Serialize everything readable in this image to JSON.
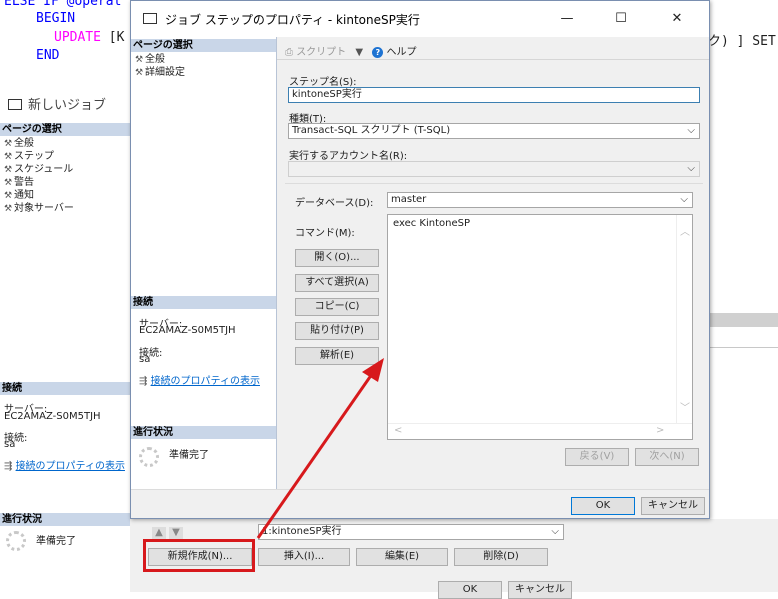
{
  "background_editor": {
    "line1": "ELSE IF @operat",
    "line2": "BEGIN",
    "line3_kw": "UPDATE",
    "line3_rest": "[K",
    "line4": "END",
    "right_tail": "ク) ] SET"
  },
  "background_job": {
    "title": "新しいジョブ",
    "page_select_header": "ページの選択",
    "pages": [
      "全般",
      "ステップ",
      "スケジュール",
      "警告",
      "通知",
      "対象サーバー"
    ],
    "connection_header": "接続",
    "server_label": "サーバー:",
    "server_value": "EC2AMAZ-S0M5TJH",
    "connection_label": "接続:",
    "connection_value": "sa",
    "connection_link": "接続のプロパティの表示",
    "progress_header": "進行状況",
    "progress_status": "準備完了",
    "step_combo_value": "1:kintoneSP実行",
    "buttons": {
      "new": "新規作成(N)...",
      "insert": "挿入(I)...",
      "edit": "編集(E)",
      "delete": "削除(D)",
      "ok": "OK",
      "cancel": "キャンセル"
    }
  },
  "dialog": {
    "title": "ジョブ ステップのプロパティ - kintoneSP実行",
    "left": {
      "page_select_header": "ページの選択",
      "pages": [
        "全般",
        "詳細設定"
      ],
      "connection_header": "接続",
      "server_label": "サーバー:",
      "server_value": "EC2AMAZ-S0M5TJH",
      "connection_label": "接続:",
      "connection_value": "sa",
      "connection_link": "接続のプロパティの表示",
      "progress_header": "進行状況",
      "progress_status": "準備完了"
    },
    "toolbar": {
      "script": "スクリプト",
      "help": "ヘルプ"
    },
    "form": {
      "step_name_label": "ステップ名(S):",
      "step_name_value": "kintoneSP実行",
      "type_label": "種類(T):",
      "type_value": "Transact-SQL スクリプト (T-SQL)",
      "account_label": "実行するアカウント名(R):",
      "account_value": "",
      "database_label": "データベース(D):",
      "database_value": "master",
      "command_label": "コマンド(M):",
      "command_value": "exec KintoneSP"
    },
    "side_buttons": {
      "open": "開く(O)...",
      "select_all": "すべて選択(A)",
      "copy": "コピー(C)",
      "paste": "貼り付け(P)",
      "parse": "解析(E)"
    },
    "nav": {
      "prev": "戻る(V)",
      "next": "次へ(N)"
    },
    "footer": {
      "ok": "OK",
      "cancel": "キャンセル"
    }
  },
  "colors": {
    "annotation_red": "#d7191c"
  }
}
